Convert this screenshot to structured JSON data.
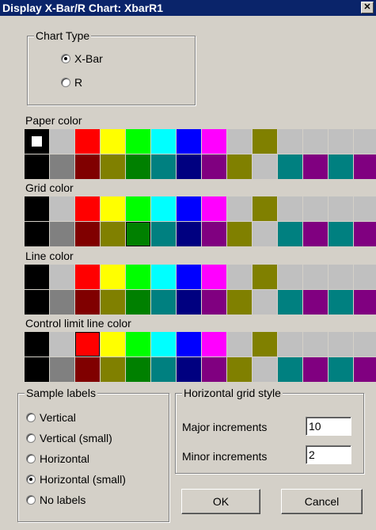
{
  "window": {
    "title": "Display X-Bar/R Chart: XbarR1",
    "close_glyph": "✕"
  },
  "chart_type": {
    "title": "Chart Type",
    "options": [
      {
        "label": "X-Bar",
        "checked": true
      },
      {
        "label": "R",
        "checked": false
      }
    ]
  },
  "palette_colors": {
    "top": [
      "#000000",
      "#c0c0c0",
      "#ff0000",
      "#ffff00",
      "#00ff00",
      "#00ffff",
      "#0000ff",
      "#ff00ff",
      "#c0c0c0",
      "#808000",
      "#c0c0c0",
      "#c0c0c0",
      "#c0c0c0",
      "#c0c0c0"
    ],
    "bottom": [
      "#000000",
      "#808080",
      "#800000",
      "#808000",
      "#008000",
      "#008080",
      "#000080",
      "#800080",
      "#808000",
      "#c0c0c0",
      "#008080",
      "#800080",
      "#008080",
      "#800080"
    ]
  },
  "color_sections": [
    {
      "label": "Paper color",
      "selected": {
        "row": "top",
        "index": 0
      }
    },
    {
      "label": "Grid color",
      "selected": {
        "row": "bottom",
        "index": 4
      }
    },
    {
      "label": "Line color",
      "selected": {
        "row": "bottom",
        "index": 0
      }
    },
    {
      "label": "Control limit line color",
      "selected": {
        "row": "top",
        "index": 2
      }
    }
  ],
  "sample_labels": {
    "title": "Sample labels",
    "options": [
      {
        "label": "Vertical",
        "checked": false
      },
      {
        "label": "Vertical (small)",
        "checked": false
      },
      {
        "label": "Horizontal",
        "checked": false
      },
      {
        "label": "Horizontal (small)",
        "checked": true
      },
      {
        "label": "No labels",
        "checked": false
      }
    ]
  },
  "grid_style": {
    "title": "Horizontal grid style",
    "major_label": "Major increments",
    "major_value": "10",
    "minor_label": "Minor increments",
    "minor_value": "2"
  },
  "buttons": {
    "ok": "OK",
    "cancel": "Cancel"
  }
}
